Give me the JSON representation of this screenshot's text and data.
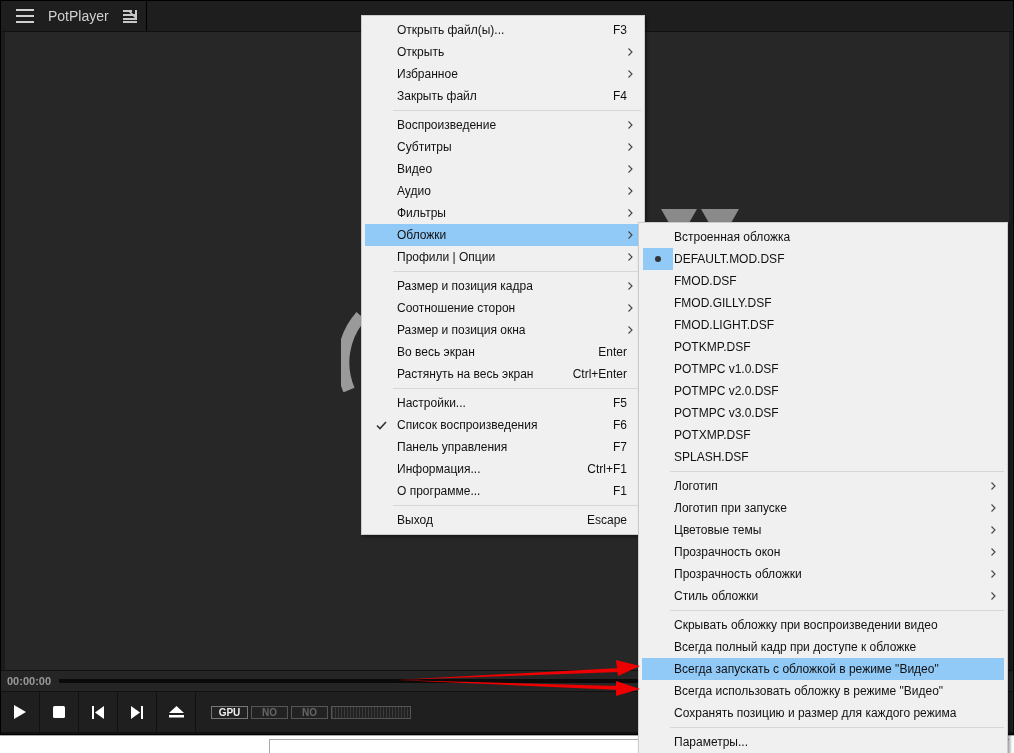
{
  "title_bar": {
    "title": "PotPlayer"
  },
  "main_menu": {
    "items": [
      {
        "kind": "item",
        "label": "Открыть файл(ы)...",
        "shortcut": "F3",
        "submenu": false,
        "checked": false,
        "selected": false
      },
      {
        "kind": "item",
        "label": "Открыть",
        "submenu": true,
        "checked": false,
        "selected": false
      },
      {
        "kind": "item",
        "label": "Избранное",
        "submenu": true,
        "checked": false,
        "selected": false
      },
      {
        "kind": "item",
        "label": "Закрыть файл",
        "shortcut": "F4",
        "submenu": false,
        "checked": false,
        "selected": false
      },
      {
        "kind": "separator"
      },
      {
        "kind": "item",
        "label": "Воспроизведение",
        "submenu": true,
        "checked": false,
        "selected": false
      },
      {
        "kind": "item",
        "label": "Субтитры",
        "submenu": true,
        "checked": false,
        "selected": false
      },
      {
        "kind": "item",
        "label": "Видео",
        "submenu": true,
        "checked": false,
        "selected": false
      },
      {
        "kind": "item",
        "label": "Аудио",
        "submenu": true,
        "checked": false,
        "selected": false
      },
      {
        "kind": "item",
        "label": "Фильтры",
        "submenu": true,
        "checked": false,
        "selected": false
      },
      {
        "kind": "item",
        "label": "Обложки",
        "submenu": true,
        "checked": false,
        "selected": true
      },
      {
        "kind": "item",
        "label": "Профили | Опции",
        "submenu": true,
        "checked": false,
        "selected": false
      },
      {
        "kind": "separator"
      },
      {
        "kind": "item",
        "label": "Размер и позиция кадра",
        "submenu": true,
        "checked": false,
        "selected": false
      },
      {
        "kind": "item",
        "label": "Соотношение сторон",
        "submenu": true,
        "checked": false,
        "selected": false
      },
      {
        "kind": "item",
        "label": "Размер и позиция окна",
        "submenu": true,
        "checked": false,
        "selected": false
      },
      {
        "kind": "item",
        "label": "Во весь экран",
        "shortcut": "Enter",
        "submenu": false,
        "checked": false,
        "selected": false
      },
      {
        "kind": "item",
        "label": "Растянуть на весь экран",
        "shortcut": "Ctrl+Enter",
        "submenu": false,
        "checked": false,
        "selected": false
      },
      {
        "kind": "separator"
      },
      {
        "kind": "item",
        "label": "Настройки...",
        "shortcut": "F5",
        "submenu": false,
        "checked": false,
        "selected": false
      },
      {
        "kind": "item",
        "label": "Список воспроизведения",
        "shortcut": "F6",
        "submenu": false,
        "checked": true,
        "selected": false
      },
      {
        "kind": "item",
        "label": "Панель управления",
        "shortcut": "F7",
        "submenu": false,
        "checked": false,
        "selected": false
      },
      {
        "kind": "item",
        "label": "Информация...",
        "shortcut": "Ctrl+F1",
        "submenu": false,
        "checked": false,
        "selected": false
      },
      {
        "kind": "item",
        "label": "О программе...",
        "shortcut": "F1",
        "submenu": false,
        "checked": false,
        "selected": false
      },
      {
        "kind": "separator"
      },
      {
        "kind": "item",
        "label": "Выход",
        "shortcut": "Escape",
        "submenu": false,
        "checked": false,
        "selected": false
      }
    ]
  },
  "skins_submenu": {
    "items": [
      {
        "kind": "item",
        "label": "Встроенная обложка",
        "submenu": false,
        "checked": false,
        "selected": false
      },
      {
        "kind": "item",
        "label": "DEFAULT.MOD.DSF",
        "submenu": false,
        "checked": true,
        "selected": false
      },
      {
        "kind": "item",
        "label": "FMOD.DSF",
        "submenu": false,
        "checked": false,
        "selected": false
      },
      {
        "kind": "item",
        "label": "FMOD.GILLY.DSF",
        "submenu": false,
        "checked": false,
        "selected": false
      },
      {
        "kind": "item",
        "label": "FMOD.LIGHT.DSF",
        "submenu": false,
        "checked": false,
        "selected": false
      },
      {
        "kind": "item",
        "label": "POTKMP.DSF",
        "submenu": false,
        "checked": false,
        "selected": false
      },
      {
        "kind": "item",
        "label": "POTMPC v1.0.DSF",
        "submenu": false,
        "checked": false,
        "selected": false
      },
      {
        "kind": "item",
        "label": "POTMPC v2.0.DSF",
        "submenu": false,
        "checked": false,
        "selected": false
      },
      {
        "kind": "item",
        "label": "POTMPC v3.0.DSF",
        "submenu": false,
        "checked": false,
        "selected": false
      },
      {
        "kind": "item",
        "label": "POTXMP.DSF",
        "submenu": false,
        "checked": false,
        "selected": false
      },
      {
        "kind": "item",
        "label": "SPLASH.DSF",
        "submenu": false,
        "checked": false,
        "selected": false
      },
      {
        "kind": "separator"
      },
      {
        "kind": "item",
        "label": "Логотип",
        "submenu": true,
        "checked": false,
        "selected": false
      },
      {
        "kind": "item",
        "label": "Логотип при запуске",
        "submenu": true,
        "checked": false,
        "selected": false
      },
      {
        "kind": "item",
        "label": "Цветовые темы",
        "submenu": true,
        "checked": false,
        "selected": false
      },
      {
        "kind": "item",
        "label": "Прозрачность окон",
        "submenu": true,
        "checked": false,
        "selected": false
      },
      {
        "kind": "item",
        "label": "Прозрачность обложки",
        "submenu": true,
        "checked": false,
        "selected": false
      },
      {
        "kind": "item",
        "label": "Стиль обложки",
        "submenu": true,
        "checked": false,
        "selected": false
      },
      {
        "kind": "separator"
      },
      {
        "kind": "item",
        "label": "Скрывать обложку при воспроизведении видео",
        "submenu": false,
        "checked": false,
        "selected": false
      },
      {
        "kind": "item",
        "label": "Всегда полный кадр при доступе к обложке",
        "submenu": false,
        "checked": false,
        "selected": false
      },
      {
        "kind": "item",
        "label": "Всегда запускать с обложкой в режиме \"Видео\"",
        "submenu": false,
        "checked": false,
        "selected": true
      },
      {
        "kind": "item",
        "label": "Всегда использовать обложку в режиме \"Видео\"",
        "submenu": false,
        "checked": false,
        "selected": false
      },
      {
        "kind": "item",
        "label": "Сохранять позицию и размер для каждого режима",
        "submenu": false,
        "checked": false,
        "selected": false
      },
      {
        "kind": "separator"
      },
      {
        "kind": "item",
        "label": "Параметры...",
        "submenu": false,
        "checked": false,
        "selected": false
      }
    ]
  },
  "seek_bar": {
    "time": "00:00:00"
  },
  "controls": {
    "buttons": [
      {
        "kind": "play"
      },
      {
        "kind": "stop"
      },
      {
        "kind": "previous"
      },
      {
        "kind": "next"
      },
      {
        "kind": "eject"
      }
    ],
    "badges": [
      {
        "label": "GPU",
        "on": true
      },
      {
        "label": "NO",
        "on": false
      },
      {
        "label": "NO",
        "on": false
      }
    ]
  }
}
